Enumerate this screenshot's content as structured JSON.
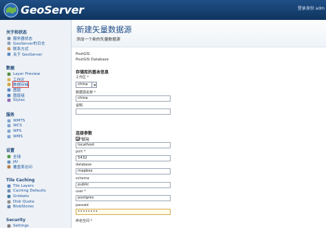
{
  "header": {
    "app_name": "GeoServer",
    "user_info": "登录身份 adm"
  },
  "sidebar": {
    "sections": [
      {
        "title": "关于和状态",
        "items": [
          {
            "label": "服务器状态",
            "icon": "server-status-icon",
            "color": "#7a8fa8"
          },
          {
            "label": "GeoServer的日志",
            "icon": "log-icon",
            "color": "#8aa0b8"
          },
          {
            "label": "联系方式",
            "icon": "contact-icon",
            "color": "#c49b6b"
          },
          {
            "label": "关于 GeoServer",
            "icon": "about-icon",
            "color": "#5b89c4"
          }
        ]
      },
      {
        "title": "数据",
        "items": [
          {
            "label": "Layer Preview",
            "icon": "layer-preview-icon",
            "color": "#4f8f3f"
          },
          {
            "label": "工作区",
            "icon": "workspace-icon",
            "color": "#d6b35a"
          },
          {
            "label": "数据存储",
            "icon": "store-icon",
            "color": "#d4a640",
            "active": true
          },
          {
            "label": "图层",
            "icon": "layer-icon",
            "color": "#5a86c2"
          },
          {
            "label": "图层组",
            "icon": "layer-group-icon",
            "color": "#4d7fbf"
          },
          {
            "label": "Styles",
            "icon": "style-icon",
            "color": "#8e6bb3"
          }
        ]
      },
      {
        "title": "服务",
        "items": [
          {
            "label": "WMTS",
            "icon": "wmts-icon",
            "color": "#7fa3cf"
          },
          {
            "label": "WCS",
            "icon": "wcs-icon",
            "color": "#7fa3cf"
          },
          {
            "label": "WFS",
            "icon": "wfs-icon",
            "color": "#7fa3cf"
          },
          {
            "label": "WMS",
            "icon": "wms-icon",
            "color": "#7fa3cf"
          }
        ]
      },
      {
        "title": "设置",
        "items": [
          {
            "label": "全球",
            "icon": "global-icon",
            "color": "#4b9a4b"
          },
          {
            "label": "JAI",
            "icon": "jai-icon",
            "color": "#6b8fb8"
          },
          {
            "label": "覆盖率访问",
            "icon": "coverage-access-icon",
            "color": "#b27a4a"
          }
        ]
      },
      {
        "title": "Tile Caching",
        "items": [
          {
            "label": "Tile Layers",
            "icon": "tile-layers-icon",
            "color": "#5a86c2"
          },
          {
            "label": "Caching Defaults",
            "icon": "caching-defaults-icon",
            "color": "#6f8db0"
          },
          {
            "label": "Gridsets",
            "icon": "gridsets-icon",
            "color": "#3f7a9f"
          },
          {
            "label": "Disk Quota",
            "icon": "disk-quota-icon",
            "color": "#8d8d8d"
          },
          {
            "label": "BlobStores",
            "icon": "blobstores-icon",
            "color": "#6c8bb3"
          }
        ]
      },
      {
        "title": "Security",
        "items": [
          {
            "label": "Settings",
            "icon": "security-settings-icon",
            "color": "#7a7a7a"
          }
        ]
      }
    ]
  },
  "main": {
    "title": "新建矢量数据源",
    "subtitle": "添加一个新的矢量数据源",
    "source_type": "PostGIS",
    "source_desc": "PostGIS Database",
    "basic_header": "存储库的基本信息",
    "workspace_label": "工作区 *",
    "workspace_value": "china",
    "name_label": "数据源名称 *",
    "name_value": "china",
    "desc_label": "说明",
    "desc_value": "",
    "enabled_label": "启用",
    "conn_header": "连接参数",
    "params": [
      {
        "label": "host *",
        "value": "localhost"
      },
      {
        "label": "port *",
        "value": "5432"
      },
      {
        "label": "database",
        "value": "mapbox"
      },
      {
        "label": "schema",
        "value": "public"
      },
      {
        "label": "user *",
        "value": "postgres"
      },
      {
        "label": "passwd",
        "value": "••••••••"
      }
    ],
    "next_label": "命名空间 *"
  }
}
